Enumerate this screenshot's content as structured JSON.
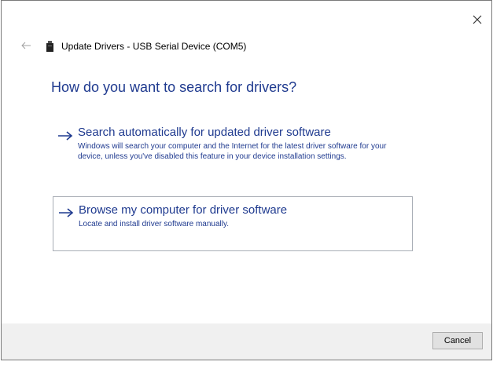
{
  "window": {
    "close_icon": "close-icon",
    "back_icon": "back-arrow-icon",
    "device_icon": "usb-device-icon",
    "title": "Update Drivers - USB Serial Device (COM5)"
  },
  "main": {
    "heading": "How do you want to search for drivers?",
    "options": [
      {
        "icon": "arrow-right-icon",
        "title": "Search automatically for updated driver software",
        "description": "Windows will search your computer and the Internet for the latest driver software for your device, unless you've disabled this feature in your device installation settings."
      },
      {
        "icon": "arrow-right-icon",
        "title": "Browse my computer for driver software",
        "description": "Locate and install driver software manually."
      }
    ]
  },
  "footer": {
    "cancel_label": "Cancel"
  },
  "colors": {
    "link_blue": "#1f3a8f",
    "footer_bg": "#f0f0f0",
    "border": "#7a7a7a"
  }
}
